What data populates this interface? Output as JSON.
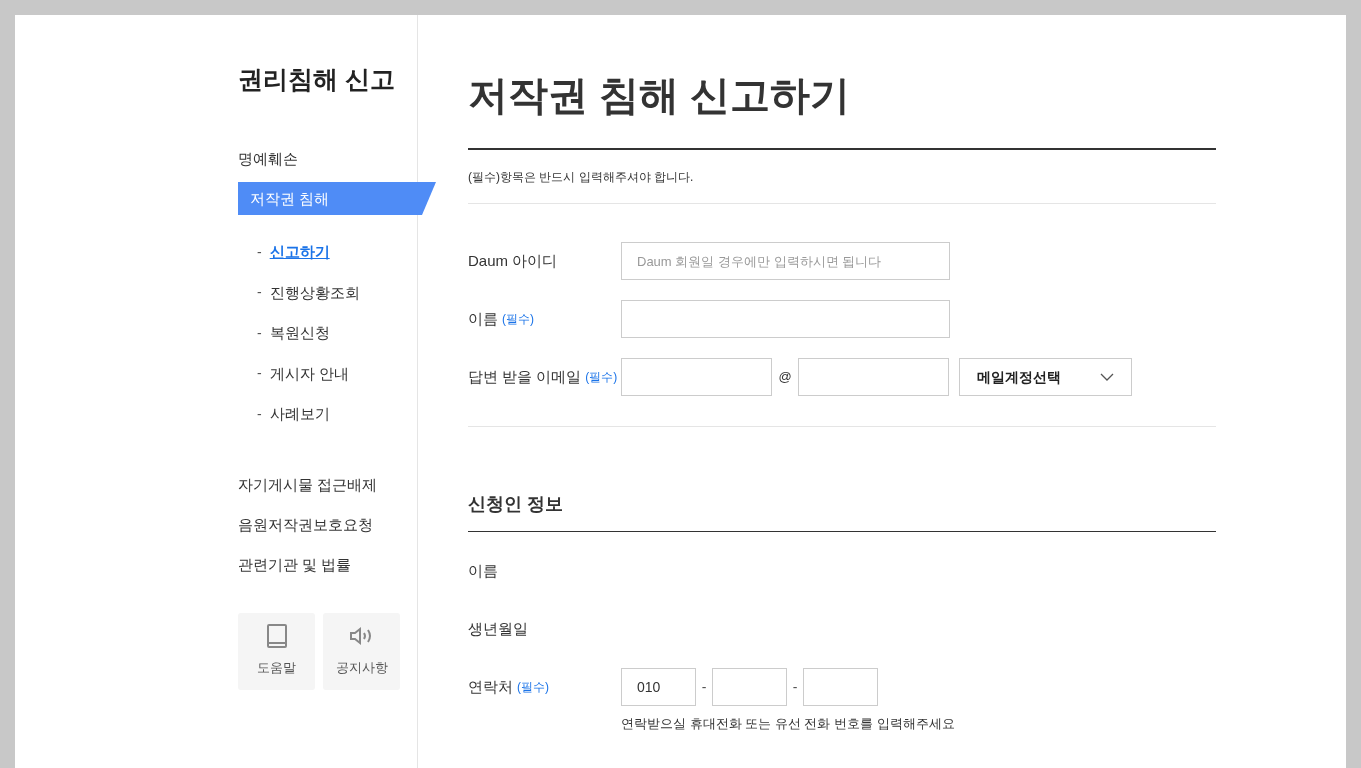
{
  "sidebar": {
    "title": "권리침해 신고",
    "items": [
      {
        "label": "명예훼손",
        "selected": false
      },
      {
        "label": "저작권 침해",
        "selected": true,
        "children": [
          {
            "bullet": "-",
            "label": "신고하기",
            "selected": true
          },
          {
            "bullet": "-",
            "label": "진행상황조회",
            "selected": false
          },
          {
            "bullet": "-",
            "label": "복원신청",
            "selected": false
          },
          {
            "bullet": "-",
            "label": "게시자 안내",
            "selected": false
          },
          {
            "bullet": "-",
            "label": "사례보기",
            "selected": false
          }
        ]
      },
      {
        "label": "자기게시물 접근배제",
        "selected": false
      },
      {
        "label": "음원저작권보호요청",
        "selected": false
      },
      {
        "label": "관련기관 및 법률",
        "selected": false
      }
    ],
    "buttons": [
      {
        "label": "도움말",
        "kind": "book"
      },
      {
        "label": "공지사항",
        "kind": "speaker"
      }
    ]
  },
  "main": {
    "title": "저작권 침해 신고하기",
    "notice": "(필수)항목은 반드시 입력해주셔야 합니다.",
    "form": [
      {
        "label": "Daum 아이디",
        "kind": "text",
        "placeholder": "Daum 회원일 경우에만 입력하시면 됩니다"
      },
      {
        "label": "이름",
        "required": "(필수)",
        "kind": "text"
      },
      {
        "label": "답변 받을 이메일",
        "required": "(필수)",
        "kind": "email",
        "separator": "@",
        "select": "메일계정선택"
      }
    ],
    "section": {
      "title": "신청인 정보",
      "rows": [
        {
          "label": "이름",
          "kind": "static"
        },
        {
          "label": "생년월일",
          "kind": "static"
        },
        {
          "label": "연락처",
          "required": "(필수)",
          "kind": "phone",
          "parts": [
            {
              "kind": "filled",
              "value": "010"
            },
            {
              "kind": "blank"
            },
            {
              "kind": "blank"
            }
          ],
          "separator": "-",
          "hint": "연락받으실 휴대전화 또는 유선 전화 번호를 입력해주세요"
        }
      ]
    }
  }
}
